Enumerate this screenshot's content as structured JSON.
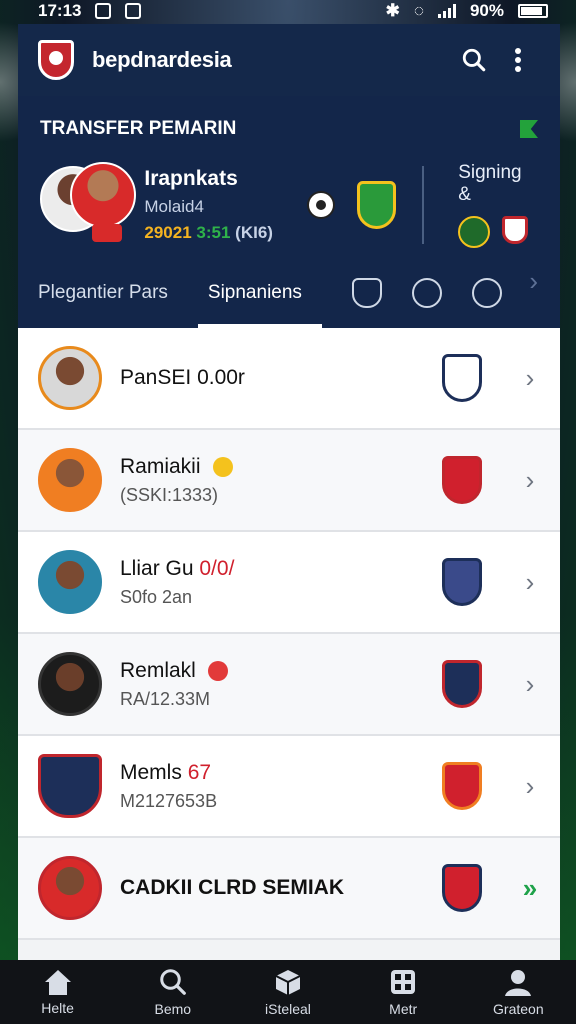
{
  "status_bar": {
    "time": "17:13",
    "battery": "90%"
  },
  "app": {
    "title": "bepdnardesia"
  },
  "transfer": {
    "heading": "TRANSFER PEMARIN",
    "player_name": "Irapnkats",
    "player_sub": "Molaid4",
    "stats_a": "29021",
    "stats_b": "3:51",
    "stats_c": "(KI6)",
    "signing_title": "Signing &"
  },
  "tabs": [
    {
      "label": "Plegantier Pars"
    },
    {
      "label": "Sipnaniens"
    }
  ],
  "players": [
    {
      "name": "PanSEI",
      "name_extra": "0.00r",
      "sub": "",
      "avatar_color": "#e88a1c",
      "badge_color": "#1d2f59",
      "badge_fill": "#ffffff"
    },
    {
      "name": "Ramiakii",
      "name_extra": "",
      "sub": "(SSKI:1333)",
      "avatar_color": "#f07e22",
      "badge_color": "#c0262d",
      "badge_fill": "#d0202d"
    },
    {
      "name": "Lliar Gu",
      "name_extra": "0/0/",
      "sub": "S0fo 2an",
      "avatar_color": "#2a86a8",
      "badge_color": "#1d2f59",
      "badge_fill": "#3a4a8a"
    },
    {
      "name": "Remlakl",
      "name_extra": "",
      "sub": "RA/12.33M",
      "avatar_color": "#333333",
      "badge_color": "#c0262d",
      "badge_fill": "#1d2f59"
    },
    {
      "name": "Memls",
      "name_extra": "67",
      "sub": "M2127653B",
      "avatar_color": "#c0262d",
      "badge_color": "#f07e22",
      "badge_fill": "#d0202d"
    },
    {
      "name": "CADKII CLRD SEMIAK",
      "name_extra": "",
      "sub": "",
      "avatar_color": "#c0262d",
      "badge_color": "#1d2f59",
      "badge_fill": "#d0202d"
    }
  ],
  "bottom_nav": [
    {
      "label": "Helte",
      "icon": "home-icon"
    },
    {
      "label": "Bemo",
      "icon": "search-icon"
    },
    {
      "label": "iSteleal",
      "icon": "cube-icon"
    },
    {
      "label": "Metr",
      "icon": "grid-icon"
    },
    {
      "label": "Grateon",
      "icon": "user-icon"
    }
  ]
}
